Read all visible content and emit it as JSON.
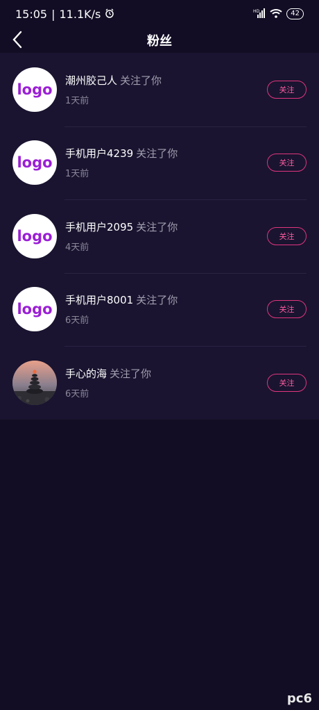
{
  "status": {
    "time": "15:05",
    "speed": "11.1K/s",
    "battery": "42",
    "network": "HD"
  },
  "header": {
    "title": "粉丝"
  },
  "fans": [
    {
      "name": "潮州胶己人",
      "action": "关注了你",
      "time": "1天前",
      "avatar": "logo",
      "button": "关注"
    },
    {
      "name": "手机用户4239",
      "action": "关注了你",
      "time": "1天前",
      "avatar": "logo",
      "button": "关注"
    },
    {
      "name": "手机用户2095",
      "action": "关注了你",
      "time": "4天前",
      "avatar": "logo",
      "button": "关注"
    },
    {
      "name": "手机用户8001",
      "action": "关注了你",
      "time": "6天前",
      "avatar": "logo",
      "button": "关注"
    },
    {
      "name": "手心的海",
      "action": "关注了你",
      "time": "6天前",
      "avatar": "photo",
      "button": "关注"
    }
  ],
  "watermark": {
    "text": "pc6"
  },
  "colors": {
    "background": "#120d24",
    "list_bg": "#1a1430",
    "accent": "#e0357e",
    "logo": "#9b1fd6"
  }
}
